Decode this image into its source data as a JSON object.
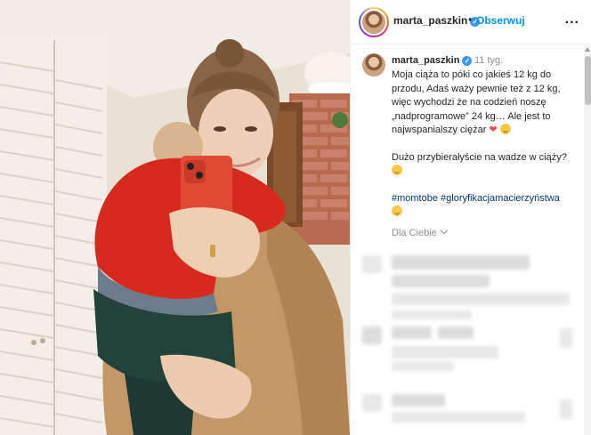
{
  "post": {
    "image_alt": "Mirror selfie of a smiling woman holding a child in a red sweater, holding a red phone"
  },
  "header": {
    "username": "marta_paszkin",
    "verified_icon": "verified-badge-icon",
    "separator": "•",
    "follow_label": "Obserwuj",
    "more_icon": "more-options-icon",
    "more_label": "..."
  },
  "caption": {
    "username": "marta_paszkin",
    "time": "11 tyg.",
    "paragraph1": "Moja ciąża to póki co jakieś 12 kg do przodu, Adaś waży pewnie też z 12 kg, więc wychodzi że na codzień noszę „nadprogramowe” 24 kg… Ale jest to najwspanialszy ciężar",
    "heart": "❤",
    "paragraph2": "Dużo przybierałyście na wadze w ciąży?",
    "hashtags": "#momtobe #gloryfikacjamacierzyństwa",
    "see_more_label": "Dla Ciebie"
  },
  "colors": {
    "accent": "#0095f6",
    "verified": "#3897f0",
    "muted": "#8e8e8e",
    "heart": "#ed4956"
  }
}
